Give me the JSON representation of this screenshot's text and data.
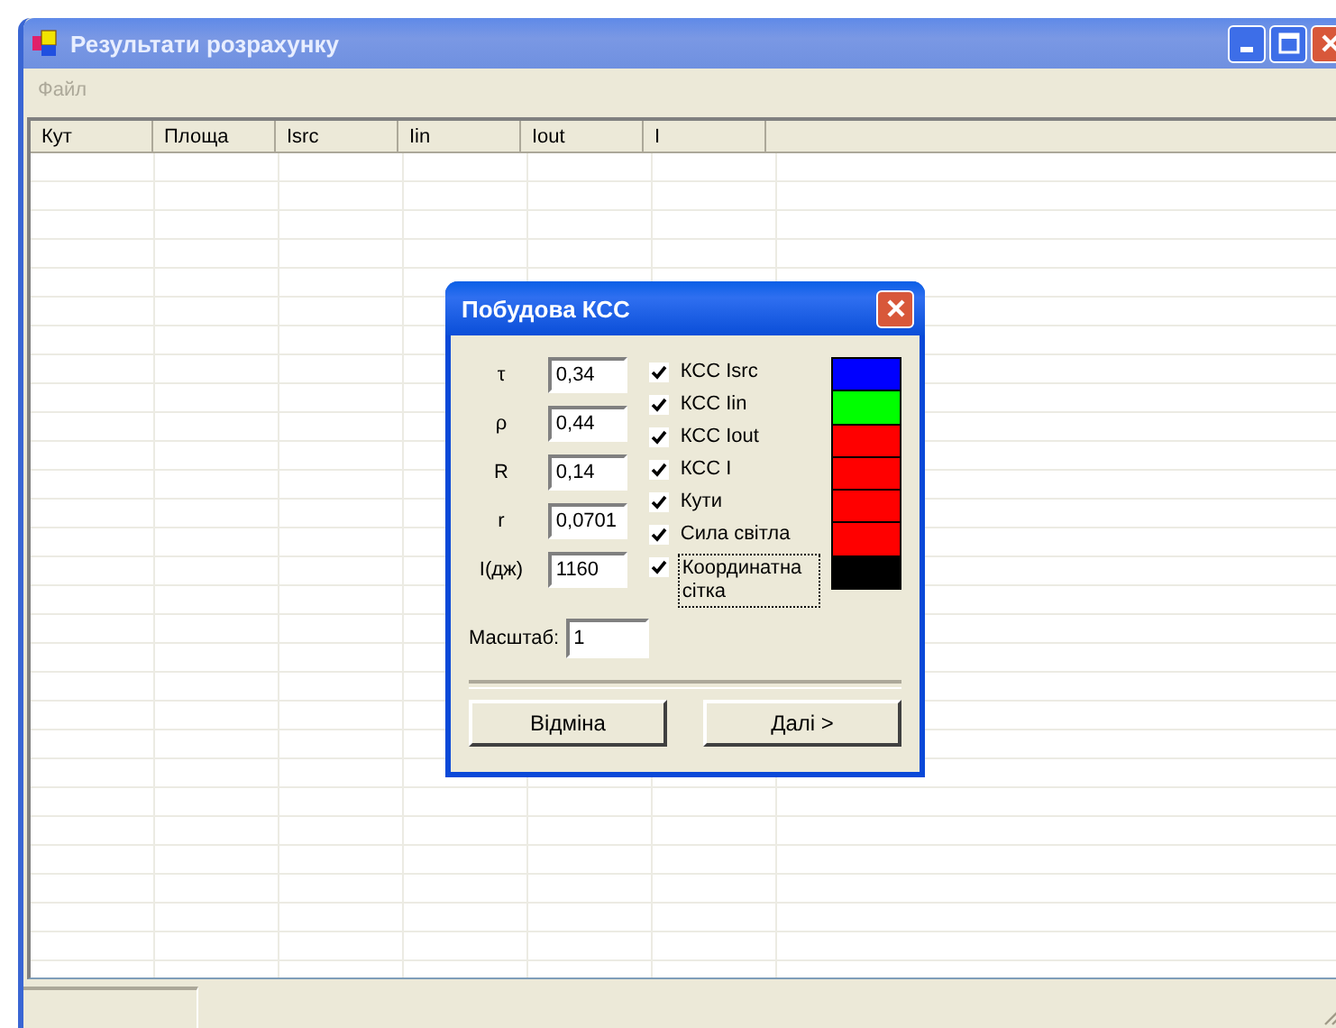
{
  "window": {
    "title": "Результати розрахунку"
  },
  "menu": [
    {
      "label": "Файл",
      "disabled": true
    }
  ],
  "table": {
    "columns": [
      "Кут",
      "Площа",
      "Isrc",
      "Iin",
      "Iout",
      "I"
    ]
  },
  "dialog": {
    "title": "Побудова КСС",
    "params": [
      {
        "label": "τ",
        "value": "0,34"
      },
      {
        "label": "ρ",
        "value": "0,44"
      },
      {
        "label": "R",
        "value": "0,14"
      },
      {
        "label": "r",
        "value": "0,0701"
      },
      {
        "label": "I(дж)",
        "value": "1160"
      }
    ],
    "options": [
      {
        "label": "КСС Isrc",
        "checked": true,
        "focused": false
      },
      {
        "label": "КСС Iin",
        "checked": true,
        "focused": false
      },
      {
        "label": "КСС Iout",
        "checked": true,
        "focused": false
      },
      {
        "label": "КСС I",
        "checked": true,
        "focused": false
      },
      {
        "label": "Кути",
        "checked": true,
        "focused": false
      },
      {
        "label": "Сила світла",
        "checked": true,
        "focused": false
      },
      {
        "label": "Координатна сітка",
        "checked": true,
        "focused": true
      }
    ],
    "colors": [
      {
        "color": "#0000ff"
      },
      {
        "color": "#00ff00"
      },
      {
        "color": "#ff0000"
      },
      {
        "color": "#ff0000"
      },
      {
        "color": "#ff0000"
      },
      {
        "color": "#ff0000"
      },
      {
        "color": "#000000"
      }
    ],
    "scale": {
      "label": "Масштаб:",
      "value": "1"
    },
    "buttons": [
      "Відміна",
      "Далі >"
    ]
  }
}
